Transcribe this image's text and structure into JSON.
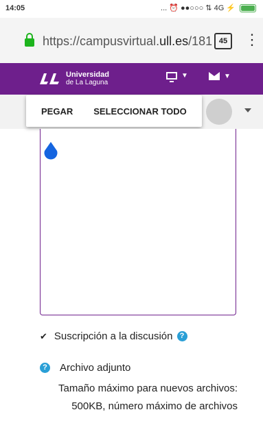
{
  "status_bar": {
    "time": "14:05",
    "indicators": "... ⏰ ●●○○○ ⇅ 4G ⚡"
  },
  "browser": {
    "url_prefix": "https://campusvirtual.",
    "url_domain": "ull.es",
    "url_rest": "/181",
    "tab_count": "45"
  },
  "header": {
    "brand_line1": "Universidad",
    "brand_line2": "de La Laguna",
    "accent_color": "#6e1f8c"
  },
  "context_menu": {
    "paste": "PEGAR",
    "select_all": "SELECCIONAR TODO"
  },
  "form": {
    "subscription_label": "Suscripción a la discusión",
    "attachment_label": "Archivo adjunto",
    "attachment_desc_line1": "Tamaño máximo para nuevos archivos:",
    "attachment_desc_line2": "500KB, número máximo de archivos"
  }
}
